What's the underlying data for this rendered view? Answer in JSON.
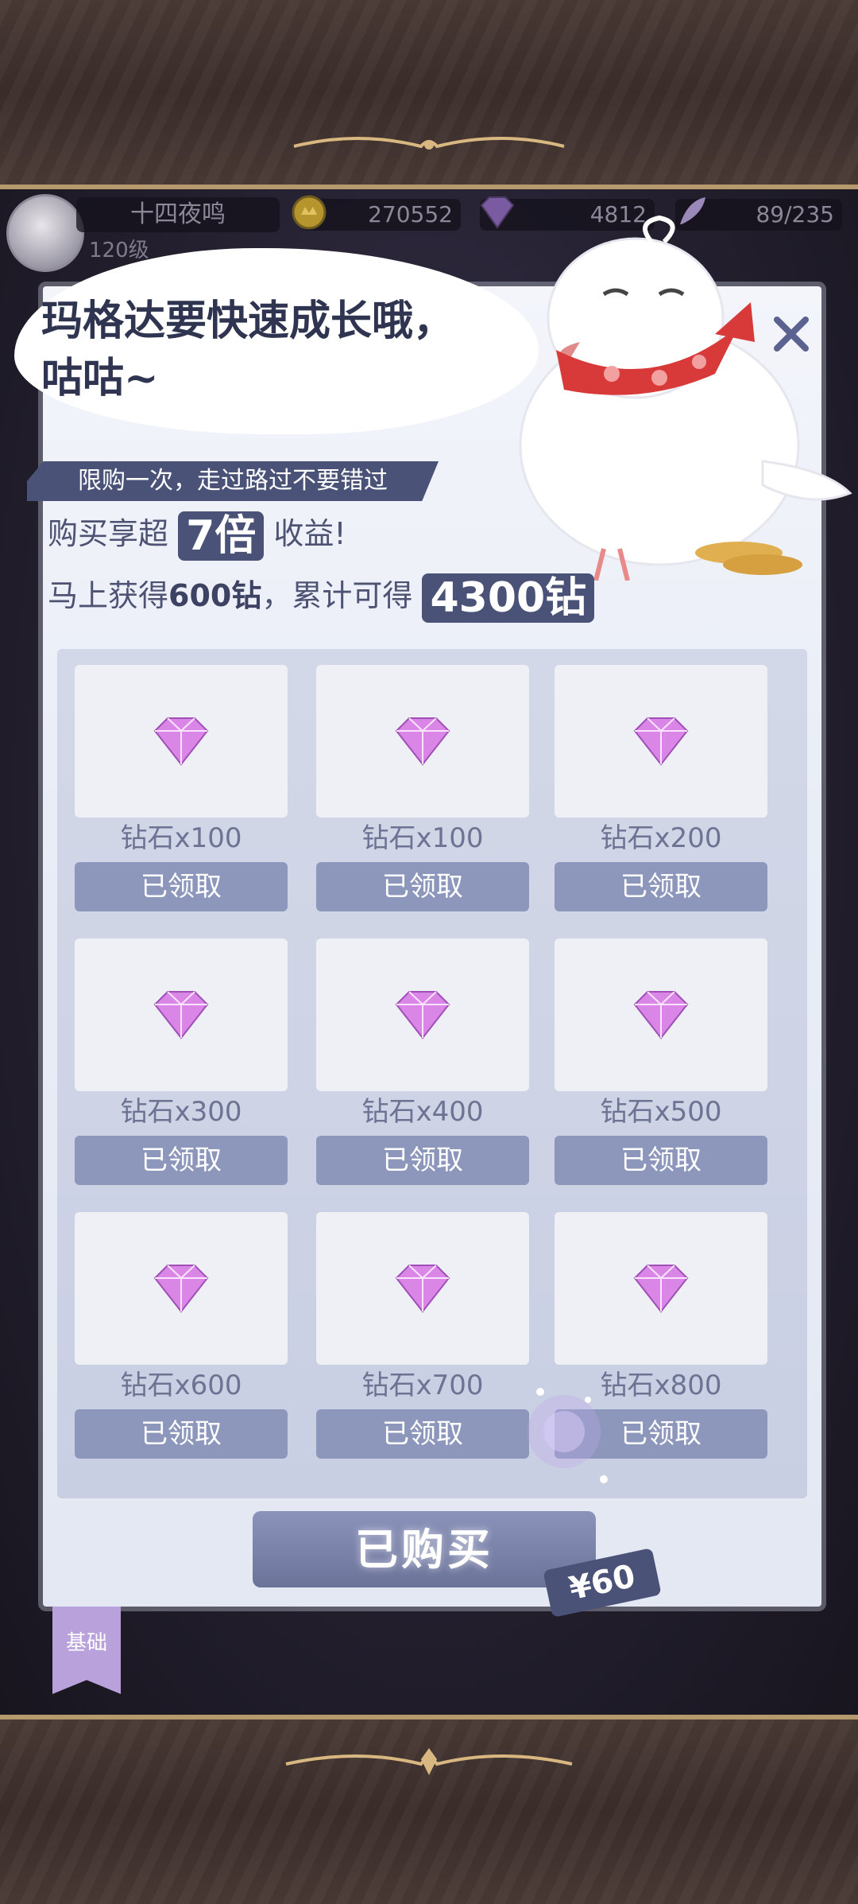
{
  "player": {
    "name": "十四夜鸣",
    "level": "120级"
  },
  "resources": {
    "coins": "270552",
    "diamonds": "4812",
    "stamina": "89/235"
  },
  "bubble": {
    "line1": "玛格达要快速成长哦，",
    "line2": "咕咕~"
  },
  "promo": {
    "ribbon": "限购一次，走过路过不要错过",
    "line1_prefix": "购买享超",
    "line1_highlight": "7倍",
    "line1_suffix": "收益!",
    "line2_prefix": "马上获得",
    "line2_bold": "600钻",
    "line2_mid": "，累计可得",
    "line2_highlight": "4300钻"
  },
  "rewards": [
    {
      "label": "钻石x100",
      "button": "已领取",
      "icon": "diamond-icon"
    },
    {
      "label": "钻石x100",
      "button": "已领取",
      "icon": "diamond-icon"
    },
    {
      "label": "钻石x200",
      "button": "已领取",
      "icon": "diamond-icon"
    },
    {
      "label": "钻石x300",
      "button": "已领取",
      "icon": "diamond-icon"
    },
    {
      "label": "钻石x400",
      "button": "已领取",
      "icon": "diamond-icon"
    },
    {
      "label": "钻石x500",
      "button": "已领取",
      "icon": "diamond-icon"
    },
    {
      "label": "钻石x600",
      "button": "已领取",
      "icon": "diamond-icon"
    },
    {
      "label": "钻石x700",
      "button": "已领取",
      "icon": "diamond-icon"
    },
    {
      "label": "钻石x800",
      "button": "已领取",
      "icon": "diamond-icon"
    }
  ],
  "buy": {
    "label": "已购买",
    "price": "¥60"
  },
  "tab": {
    "label": "基础"
  },
  "colors": {
    "accent": "#4a5278",
    "claimed": "#8d97bb",
    "tab": "#b9a1dc"
  }
}
